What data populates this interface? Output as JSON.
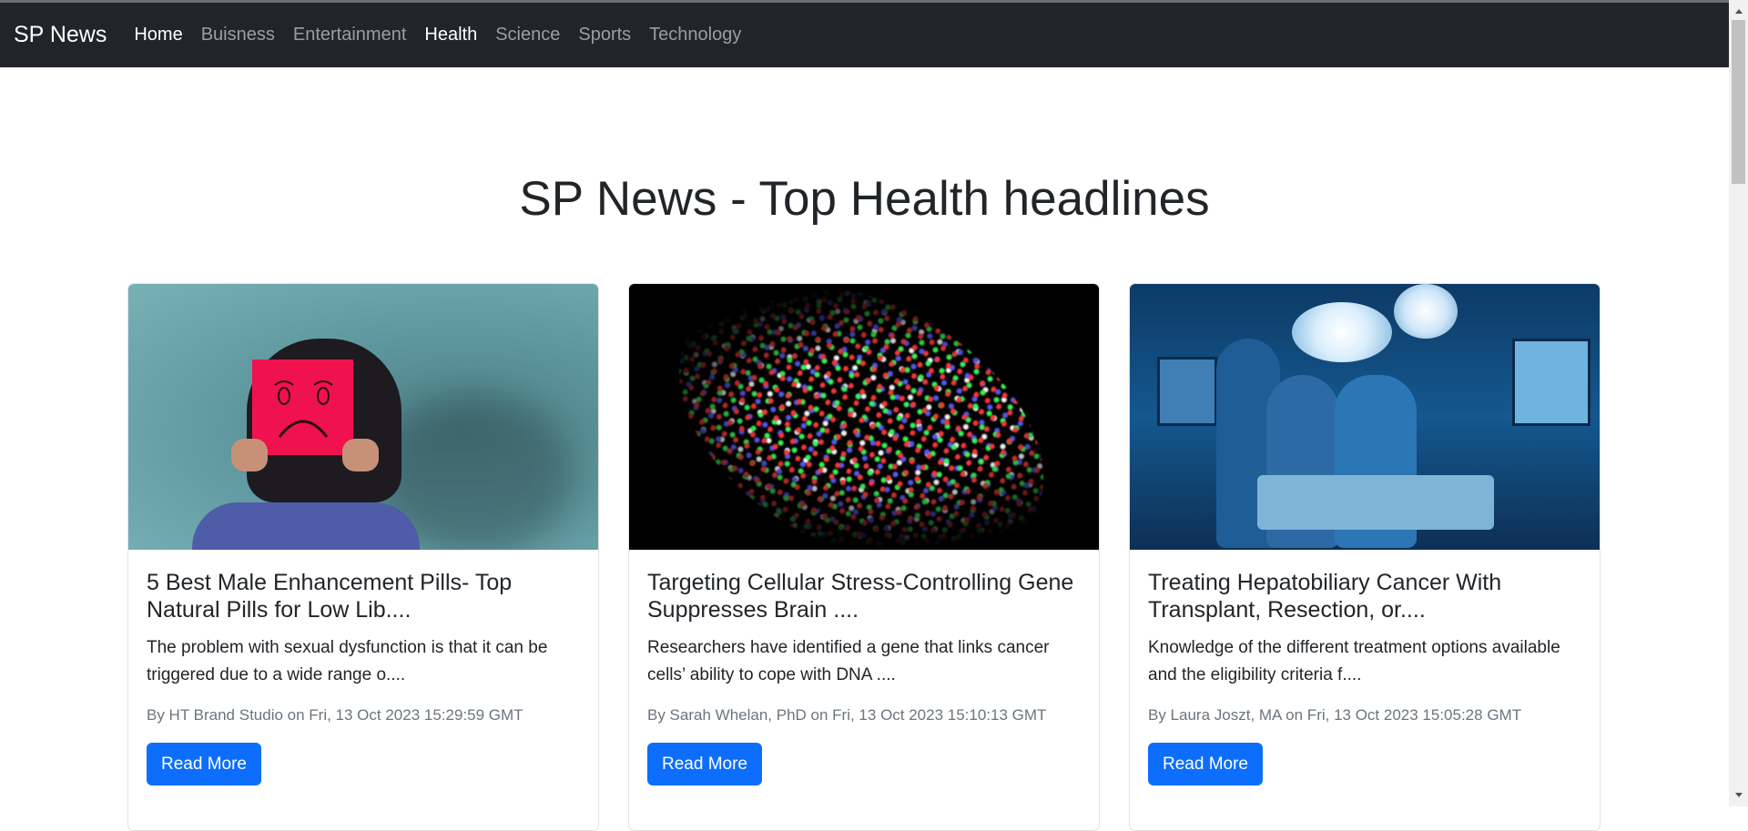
{
  "nav": {
    "brand": "SP News",
    "links": [
      "Home",
      "Buisness",
      "Entertainment",
      "Health",
      "Science",
      "Sports",
      "Technology"
    ]
  },
  "page": {
    "title": "SP News - Top Health headlines"
  },
  "articles": [
    {
      "title": "5 Best Male Enhancement Pills- Top Natural Pills for Low Lib....",
      "description": "The problem with sexual dysfunction is that it can be triggered due to a wide range o....",
      "meta": "By HT Brand Studio on Fri, 13 Oct 2023 15:29:59 GMT",
      "button": "Read More"
    },
    {
      "title": "Targeting Cellular Stress-Controlling Gene Suppresses Brain ....",
      "description": "Researchers have identified a gene that links cancer cells’ ability to cope with DNA ....",
      "meta": "By Sarah Whelan, PhD on Fri, 13 Oct 2023 15:10:13 GMT",
      "button": "Read More"
    },
    {
      "title": "Treating Hepatobiliary Cancer With Transplant, Resection, or....",
      "description": "Knowledge of the different treatment options available and the eligibility criteria f....",
      "meta": "By Laura Joszt, MA on Fri, 13 Oct 2023 15:05:28 GMT",
      "button": "Read More"
    }
  ],
  "colors": {
    "navbar": "#212529",
    "button": "#0d6efd",
    "meta_text": "#6c757d"
  }
}
